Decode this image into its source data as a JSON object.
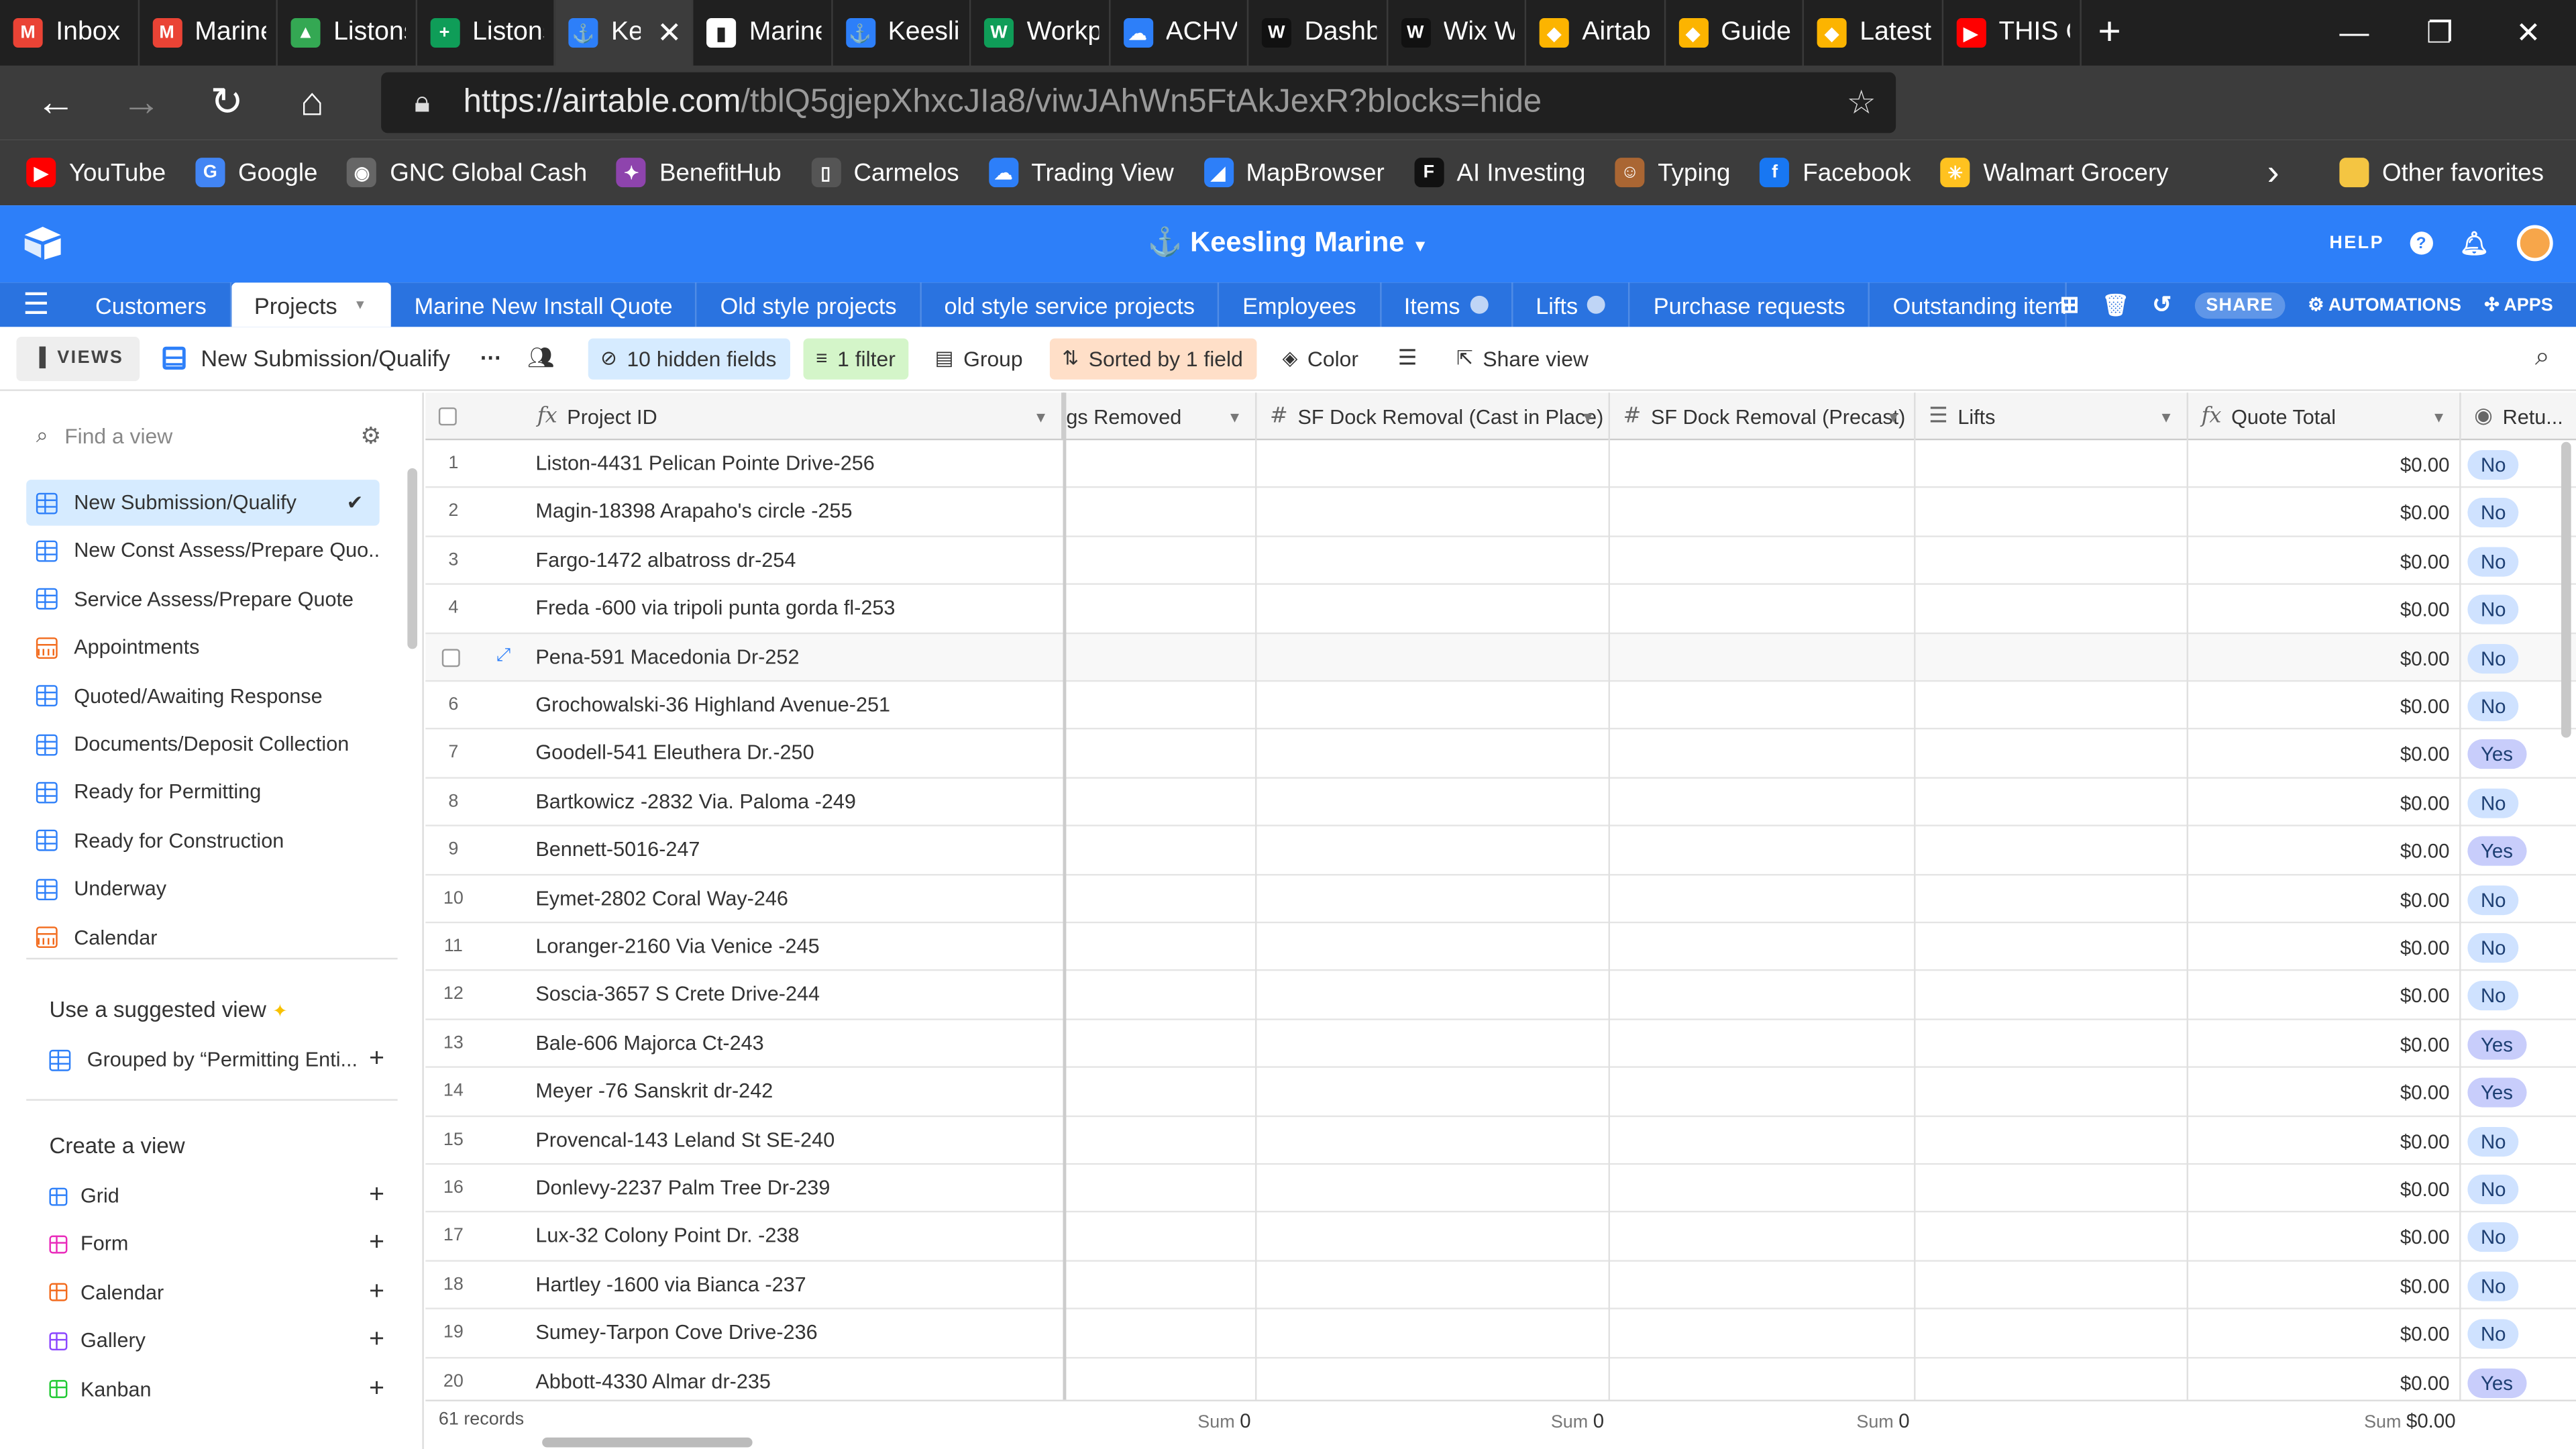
{
  "browser": {
    "tabs": [
      {
        "label": "Inbox",
        "color": "#ea4335",
        "glyph": "M",
        "w": 92
      },
      {
        "label": "Marine",
        "color": "#ea4335",
        "glyph": "M",
        "w": 86
      },
      {
        "label": "Listons",
        "color": "#34a853",
        "glyph": "▲",
        "w": 86
      },
      {
        "label": "Listons",
        "color": "#0f9d58",
        "glyph": "+",
        "w": 86
      },
      {
        "label": "Ke",
        "color": "#2d7ff9",
        "glyph": "⚓",
        "w": 82,
        "active": true
      },
      {
        "label": "Marine",
        "color": "#ffffff",
        "glyph": "▮",
        "w": 86
      },
      {
        "label": "Keeslin",
        "color": "#2d7ff9",
        "glyph": "⚓",
        "w": 86
      },
      {
        "label": "Workp",
        "color": "#0f9d58",
        "glyph": "W",
        "w": 86
      },
      {
        "label": "ACHV",
        "color": "#2d7ff9",
        "glyph": "☁",
        "w": 86
      },
      {
        "label": "Dashb",
        "color": "#111111",
        "glyph": "W",
        "w": 86
      },
      {
        "label": "Wix W",
        "color": "#111111",
        "glyph": "W",
        "w": 86
      },
      {
        "label": "Airtab",
        "color": "#fcb400",
        "glyph": "◆",
        "w": 86
      },
      {
        "label": "Guide",
        "color": "#fcb400",
        "glyph": "◆",
        "w": 86
      },
      {
        "label": "Latest",
        "color": "#fcb400",
        "glyph": "◆",
        "w": 86
      },
      {
        "label": "THIS C",
        "color": "#ff0000",
        "glyph": "▶",
        "w": 86
      }
    ],
    "url_host": "https://airtable.com",
    "url_path": "/tblQ5gjepXhxcJIa8/viwJAhWn5FtAkJexR?blocks=hide",
    "extension_badge": "1",
    "bookmarks": [
      {
        "label": "YouTube",
        "color": "#ff0000",
        "glyph": "▶"
      },
      {
        "label": "Google",
        "color": "#4285f4",
        "glyph": "G"
      },
      {
        "label": "GNC Global Cash",
        "color": "#666666",
        "glyph": "◉"
      },
      {
        "label": "BenefitHub",
        "color": "#8e44ad",
        "glyph": "✦"
      },
      {
        "label": "Carmelos",
        "color": "#555555",
        "glyph": "▯"
      },
      {
        "label": "Trading View",
        "color": "#2d7ff9",
        "glyph": "☁"
      },
      {
        "label": "MapBrowser",
        "color": "#2d7ff9",
        "glyph": "◢"
      },
      {
        "label": "AI Investing",
        "color": "#111111",
        "glyph": "F"
      },
      {
        "label": "Typing",
        "color": "#aa6633",
        "glyph": "☺"
      },
      {
        "label": "Facebook",
        "color": "#1877f2",
        "glyph": "f"
      },
      {
        "label": "Walmart Grocery",
        "color": "#ffc220",
        "glyph": "✳"
      }
    ],
    "other_favorites": "Other favorites"
  },
  "airtable": {
    "base_name": "Keesling Marine",
    "help": "HELP",
    "tables": [
      {
        "label": "Customers"
      },
      {
        "label": "Projects",
        "active": true
      },
      {
        "label": "Marine New Install Quote"
      },
      {
        "label": "Old style projects"
      },
      {
        "label": "old style service projects"
      },
      {
        "label": "Employees"
      },
      {
        "label": "Items",
        "info": true
      },
      {
        "label": "Lifts",
        "info": true
      },
      {
        "label": "Purchase requests"
      },
      {
        "label": "Outstanding item",
        "info": true
      }
    ],
    "share": "SHARE",
    "automations": "AUTOMATIONS",
    "apps": "APPS",
    "toolbar": {
      "views": "VIEWS",
      "current_view": "New Submission/Qualify",
      "hidden_fields": "10 hidden fields",
      "filter": "1 filter",
      "group": "Group",
      "sorted": "Sorted by 1 field",
      "color": "Color",
      "share_view": "Share view"
    },
    "sidebar": {
      "find_placeholder": "Find a view",
      "views": [
        {
          "label": "New Submission/Qualify",
          "type": "grid",
          "selected": true
        },
        {
          "label": "New Const Assess/Prepare Quo...",
          "type": "grid"
        },
        {
          "label": "Service Assess/Prepare Quote",
          "type": "grid"
        },
        {
          "label": "Appointments",
          "type": "calendar"
        },
        {
          "label": "Quoted/Awaiting Response",
          "type": "grid"
        },
        {
          "label": "Documents/Deposit Collection",
          "type": "grid"
        },
        {
          "label": "Ready for Permitting",
          "type": "grid"
        },
        {
          "label": "Ready for Construction",
          "type": "grid"
        },
        {
          "label": "Underway",
          "type": "grid"
        },
        {
          "label": "Calendar",
          "type": "calendar"
        }
      ],
      "suggested_heading": "Use a suggested view",
      "suggested_item": "Grouped by “Permitting Enti...",
      "create_heading": "Create a view",
      "create_items": [
        {
          "label": "Grid",
          "color": "#2d7ff9"
        },
        {
          "label": "Form",
          "color": "#e929ba"
        },
        {
          "label": "Calendar",
          "color": "#f26b1d"
        },
        {
          "label": "Gallery",
          "color": "#8b46ff"
        },
        {
          "label": "Kanban",
          "color": "#20c933"
        }
      ]
    },
    "columns": {
      "project_id": "Project ID",
      "removed": "gs Removed",
      "sf_cast": "SF Dock Removal (Cast in Place)",
      "sf_precast": "SF Dock Removal (Precast)",
      "lifts": "Lifts",
      "quote_total": "Quote Total",
      "returned": "Retu..."
    },
    "rows": [
      {
        "n": "1",
        "id": "Liston-4431 Pelican Pointe Drive-256",
        "total": "$0.00",
        "ret": "No"
      },
      {
        "n": "2",
        "id": "Magin-18398 Arapaho's circle -255",
        "total": "$0.00",
        "ret": "No"
      },
      {
        "n": "3",
        "id": "Fargo-1472 albatross dr-254",
        "total": "$0.00",
        "ret": "No"
      },
      {
        "n": "4",
        "id": "Freda -600 via tripoli punta gorda fl-253",
        "total": "$0.00",
        "ret": "No"
      },
      {
        "n": "",
        "id": "Pena-591 Macedonia Dr-252",
        "total": "$0.00",
        "ret": "No",
        "hover": true
      },
      {
        "n": "6",
        "id": "Grochowalski-36 Highland Avenue-251",
        "total": "$0.00",
        "ret": "No"
      },
      {
        "n": "7",
        "id": "Goodell-541 Eleuthera Dr.-250",
        "total": "$0.00",
        "ret": "Yes"
      },
      {
        "n": "8",
        "id": "Bartkowicz -2832 Via. Paloma -249",
        "total": "$0.00",
        "ret": "No"
      },
      {
        "n": "9",
        "id": "Bennett-5016-247",
        "total": "$0.00",
        "ret": "Yes"
      },
      {
        "n": "10",
        "id": "Eymet-2802 Coral Way-246",
        "total": "$0.00",
        "ret": "No"
      },
      {
        "n": "11",
        "id": "Loranger-2160 Via Venice -245",
        "total": "$0.00",
        "ret": "No"
      },
      {
        "n": "12",
        "id": "Soscia-3657 S Crete Drive-244",
        "total": "$0.00",
        "ret": "No"
      },
      {
        "n": "13",
        "id": "Bale-606 Majorca Ct-243",
        "total": "$0.00",
        "ret": "Yes"
      },
      {
        "n": "14",
        "id": "Meyer -76 Sanskrit dr-242",
        "total": "$0.00",
        "ret": "Yes"
      },
      {
        "n": "15",
        "id": "Provencal-143 Leland St SE-240",
        "total": "$0.00",
        "ret": "No"
      },
      {
        "n": "16",
        "id": "Donlevy-2237 Palm Tree Dr-239",
        "total": "$0.00",
        "ret": "No"
      },
      {
        "n": "17",
        "id": "Lux-32 Colony Point Dr. -238",
        "total": "$0.00",
        "ret": "No"
      },
      {
        "n": "18",
        "id": "Hartley -1600 via Bianca -237",
        "total": "$0.00",
        "ret": "No"
      },
      {
        "n": "19",
        "id": "Sumey-Tarpon Cove Drive-236",
        "total": "$0.00",
        "ret": "No"
      },
      {
        "n": "20",
        "id": "Abbott-4330 Almar dr-235",
        "total": "$0.00",
        "ret": "Yes"
      }
    ],
    "footer": {
      "records": "61 records",
      "sum_label": "Sum",
      "sum_cast": "0",
      "sum_precast": "0",
      "sum_lifts": "0",
      "sum_total": "$0.00"
    }
  }
}
